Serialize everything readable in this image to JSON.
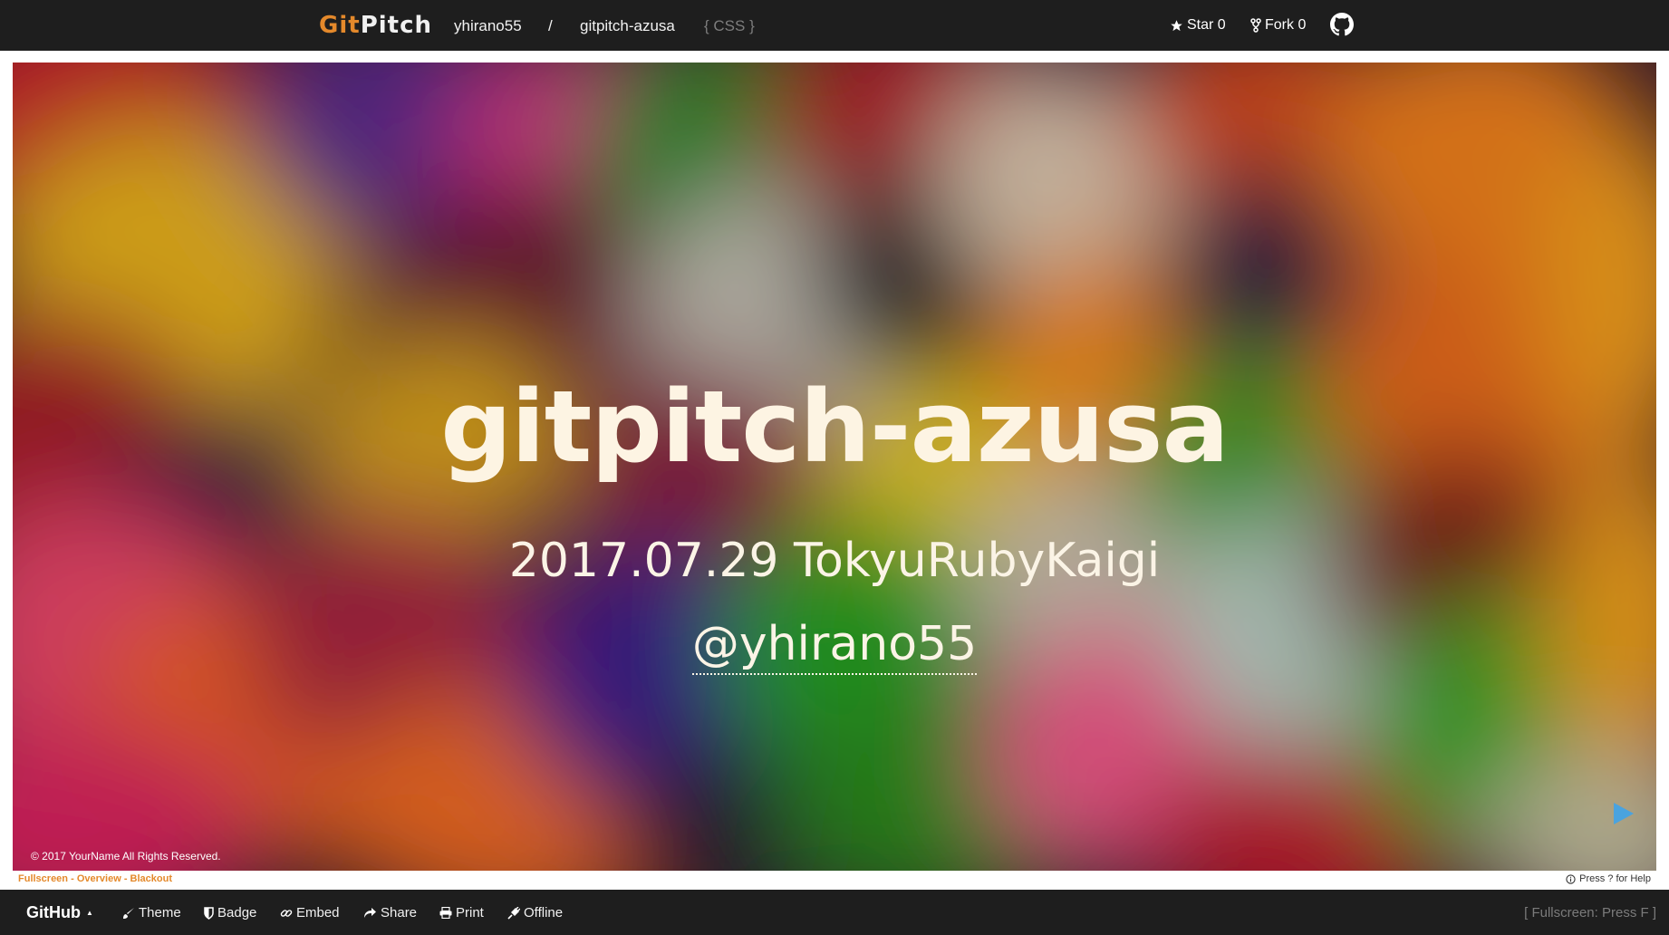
{
  "topbar": {
    "brand_git": "Git",
    "brand_pitch": "Pitch",
    "owner": "yhirano55",
    "separator": "/",
    "repo": "gitpitch-azusa",
    "theme_tag": "{ CSS }",
    "star_label": "Star 0",
    "fork_label": "Fork 0",
    "icons": {
      "star": "star-icon",
      "fork": "fork-icon",
      "github": "github-icon"
    }
  },
  "slide": {
    "title": "gitpitch-azusa",
    "subtitle": "2017.07.29 TokyuRubyKaigi",
    "handle": "@yhirano55",
    "footer": "© 2017 YourName All Rights Reserved.",
    "next_icon": "play-arrow-icon",
    "arrow_color": "#4aa3df"
  },
  "status": {
    "fullscreen": "Fullscreen",
    "overview": "Overview",
    "blackout": "Blackout",
    "dash": "-",
    "help": "Press ? for Help",
    "help_icon": "info-icon"
  },
  "bottombar": {
    "github_menu": "GitHub",
    "github_caret": "▲",
    "theme": "Theme",
    "badge": "Badge",
    "embed": "Embed",
    "share": "Share",
    "print": "Print",
    "offline": "Offline",
    "fullscreen_hint": "[ Fullscreen: Press F ]"
  },
  "colors": {
    "bar_bg": "#1e1e1e",
    "accent_orange": "#e4892b",
    "slide_text": "#fdf4e3"
  }
}
